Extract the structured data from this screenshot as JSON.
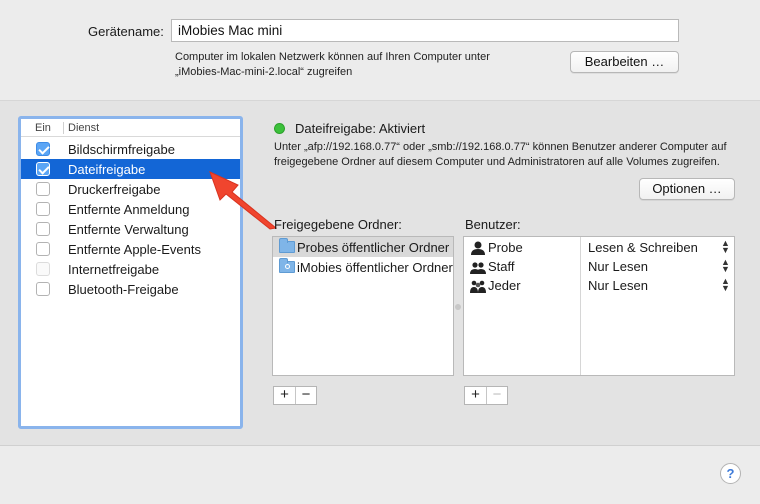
{
  "device": {
    "label": "Gerätename:",
    "name": "iMobies Mac mini",
    "desc_line1": "Computer im lokalen Netzwerk können auf Ihren Computer unter",
    "desc_line2": "„iMobies-Mac-mini-2.local“ zugreifen",
    "edit_button": "Bearbeiten …"
  },
  "services": {
    "col_on": "Ein",
    "col_service": "Dienst",
    "items": [
      {
        "label": "Bildschirmfreigabe",
        "checked": true,
        "selected": false
      },
      {
        "label": "Dateifreigabe",
        "checked": true,
        "selected": true
      },
      {
        "label": "Druckerfreigabe",
        "checked": false,
        "selected": false
      },
      {
        "label": "Entfernte Anmeldung",
        "checked": false,
        "selected": false
      },
      {
        "label": "Entfernte Verwaltung",
        "checked": false,
        "selected": false
      },
      {
        "label": "Entfernte Apple-Events",
        "checked": false,
        "selected": false
      },
      {
        "label": "Internetfreigabe",
        "checked": false,
        "selected": false
      },
      {
        "label": "Bluetooth-Freigabe",
        "checked": false,
        "selected": false
      }
    ]
  },
  "status": {
    "title": "Dateifreigabe: Aktiviert",
    "color": "#3cc13b",
    "desc": "Unter „afp://192.168.0.77“ oder „smb://192.168.0.77“ können Benutzer anderer Computer auf freigegebene Ordner auf diesem Computer und Administratoren auf alle Volumes zugreifen.",
    "options_button": "Optionen …"
  },
  "folders": {
    "label": "Freigegebene Ordner:",
    "items": [
      {
        "label": "Probes öffentlicher Ordner"
      },
      {
        "label": "iMobies öffentlicher Ordner"
      }
    ]
  },
  "users": {
    "label": "Benutzer:",
    "items": [
      {
        "name": "Probe",
        "permission": "Lesen & Schreiben",
        "icon": "single-user-icon"
      },
      {
        "name": "Staff",
        "permission": "Nur Lesen",
        "icon": "group-icon"
      },
      {
        "name": "Jeder",
        "permission": "Nur Lesen",
        "icon": "everyone-icon"
      }
    ]
  },
  "controls": {
    "plus": "+",
    "minus": "−",
    "help": "?"
  },
  "colors": {
    "selection": "#1366d6",
    "focus_ring": "#8ab4ec",
    "arrow": "#f0452e"
  }
}
